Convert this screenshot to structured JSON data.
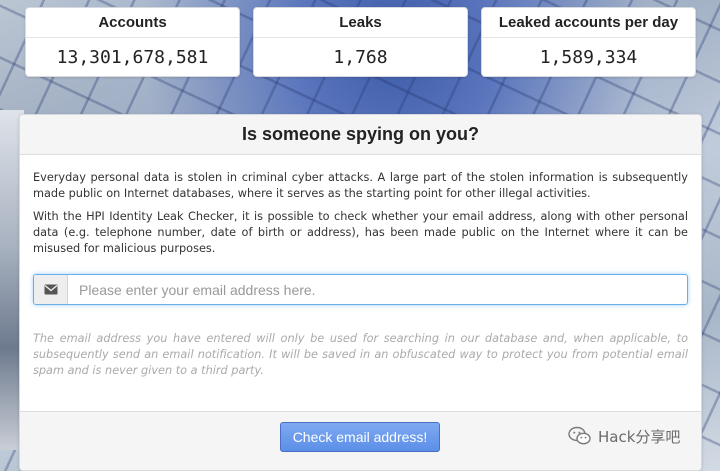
{
  "stats": [
    {
      "label": "Accounts",
      "value": "13,301,678,581"
    },
    {
      "label": "Leaks",
      "value": "1,768"
    },
    {
      "label": "Leaked accounts per day",
      "value": "1,589,334"
    }
  ],
  "panel": {
    "title": "Is someone spying on you?",
    "intro": "Everyday personal data is stolen in criminal cyber attacks. A large part of the stolen information is subsequently made public on Internet databases, where it serves as the starting point for other illegal activities.",
    "description": "With the HPI Identity Leak Checker, it is possible to check whether your email address, along with other personal data (e.g. telephone number, date of birth or address), has been made public on the Internet where it can be misused for malicious purposes.",
    "email_placeholder": "Please enter your email address here.",
    "email_value": "",
    "email_icon": "envelope-icon",
    "privacy_notice": "The email address you have entered will only be used for searching in our database and, when applicable, to subsequently send an email notification. It will be saved in an obfuscated way to protect you from potential email spam and is never given to a third party.",
    "submit_label": "Check email address!"
  },
  "watermark": {
    "text": "Hack分享吧",
    "icon": "wechat-icon"
  },
  "colors": {
    "accent": "#5b8fe8",
    "focus": "#66afe9"
  }
}
